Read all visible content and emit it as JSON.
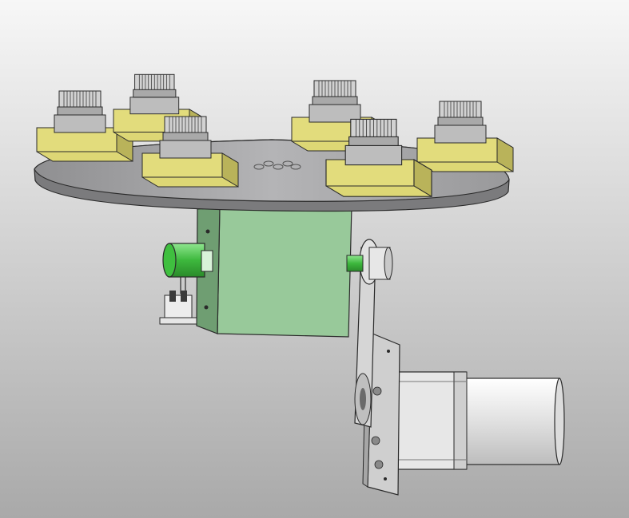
{
  "scene": {
    "kind": "cad-3d-render",
    "colors": {
      "background_top": "#f7f7f7",
      "background_bottom": "#a9a9a9",
      "plate": "#a8a8aa",
      "plate_edge": "#7b7b7d",
      "socket_base": "#ddd775",
      "socket_base_dark": "#b9b35a",
      "socket_body": "#c9c9c9",
      "hub_block": "#98c99a",
      "hub_block_dark": "#6f9e72",
      "coupling_green": "#4fc24f",
      "motor_body": "#e9e9e9",
      "bracket": "#cfcfcf",
      "outline": "#2a2a2a"
    },
    "components": [
      "rotary-plate",
      "test-socket",
      "mounting-block",
      "slip-ring-coupling",
      "belt-drive",
      "stepper-motor",
      "motor-bracket",
      "sensor-bracket"
    ]
  }
}
